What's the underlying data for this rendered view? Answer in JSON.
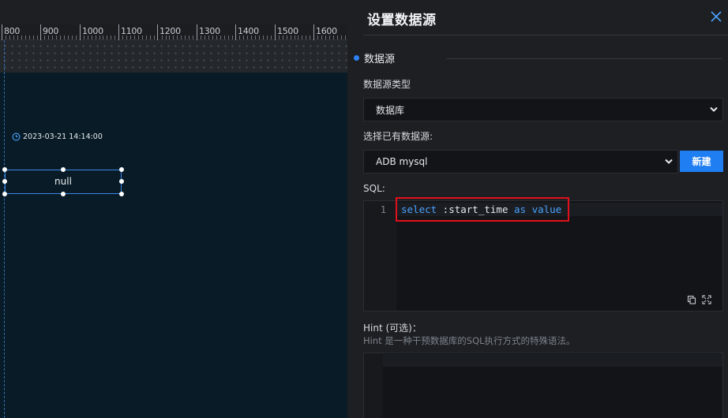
{
  "ruler": {
    "labels": [
      "800",
      "900",
      "1000",
      "1100",
      "1200",
      "1300",
      "1400",
      "1500",
      "1600"
    ]
  },
  "canvas": {
    "timestamp": "2023-03-21 14:14:00",
    "selected_text": "null"
  },
  "panel": {
    "title": "设置数据源",
    "section_title": "数据源",
    "type_label": "数据源类型",
    "type_value": "数据库",
    "existing_label": "选择已有数据源:",
    "existing_value": "ADB mysql",
    "new_button": "新建",
    "sql_label": "SQL:",
    "sql_line_number": "1",
    "sql_code": {
      "kw1": "select",
      "param": " :start_time ",
      "kw2": "as",
      "space": " ",
      "kw3": "value"
    },
    "hint_label": "Hint (可选)：",
    "hint_desc": "Hint 是一种干预数据库的SQL执行方式的特殊语法。"
  },
  "colors": {
    "accent": "#1f7ef2",
    "highlight": "#e3101c",
    "keyword": "#4aa3ff"
  },
  "icons": [
    "clock-icon",
    "close-icon",
    "chevron-down-icon",
    "copy-icon",
    "fullscreen-icon"
  ]
}
